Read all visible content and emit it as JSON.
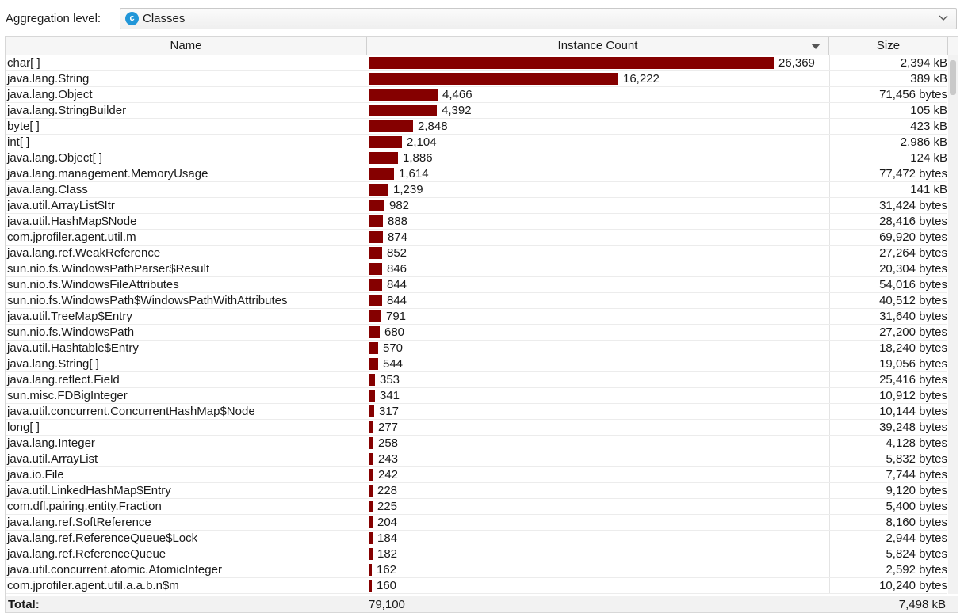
{
  "toolbar": {
    "aggregation_label": "Aggregation level:",
    "aggregation_value": "Classes",
    "aggregation_icon": "class-c-icon"
  },
  "table": {
    "columns": {
      "name": "Name",
      "instance_count": "Instance Count",
      "size": "Size"
    },
    "sort_column": "instance_count",
    "sort_direction": "descending",
    "bar_color": "#850000",
    "max_count": 26369,
    "rows": [
      {
        "name": "char[ ]",
        "count": 26369,
        "count_label": "26,369",
        "size": "2,394 kB"
      },
      {
        "name": "java.lang.String",
        "count": 16222,
        "count_label": "16,222",
        "size": "389 kB"
      },
      {
        "name": "java.lang.Object",
        "count": 4466,
        "count_label": "4,466",
        "size": "71,456 bytes"
      },
      {
        "name": "java.lang.StringBuilder",
        "count": 4392,
        "count_label": "4,392",
        "size": "105 kB"
      },
      {
        "name": "byte[ ]",
        "count": 2848,
        "count_label": "2,848",
        "size": "423 kB"
      },
      {
        "name": "int[ ]",
        "count": 2104,
        "count_label": "2,104",
        "size": "2,986 kB"
      },
      {
        "name": "java.lang.Object[ ]",
        "count": 1886,
        "count_label": "1,886",
        "size": "124 kB"
      },
      {
        "name": "java.lang.management.MemoryUsage",
        "count": 1614,
        "count_label": "1,614",
        "size": "77,472 bytes"
      },
      {
        "name": "java.lang.Class",
        "count": 1239,
        "count_label": "1,239",
        "size": "141 kB"
      },
      {
        "name": "java.util.ArrayList$Itr",
        "count": 982,
        "count_label": "982",
        "size": "31,424 bytes"
      },
      {
        "name": "java.util.HashMap$Node",
        "count": 888,
        "count_label": "888",
        "size": "28,416 bytes"
      },
      {
        "name": "com.jprofiler.agent.util.m",
        "count": 874,
        "count_label": "874",
        "size": "69,920 bytes"
      },
      {
        "name": "java.lang.ref.WeakReference",
        "count": 852,
        "count_label": "852",
        "size": "27,264 bytes"
      },
      {
        "name": "sun.nio.fs.WindowsPathParser$Result",
        "count": 846,
        "count_label": "846",
        "size": "20,304 bytes"
      },
      {
        "name": "sun.nio.fs.WindowsFileAttributes",
        "count": 844,
        "count_label": "844",
        "size": "54,016 bytes"
      },
      {
        "name": "sun.nio.fs.WindowsPath$WindowsPathWithAttributes",
        "count": 844,
        "count_label": "844",
        "size": "40,512 bytes"
      },
      {
        "name": "java.util.TreeMap$Entry",
        "count": 791,
        "count_label": "791",
        "size": "31,640 bytes"
      },
      {
        "name": "sun.nio.fs.WindowsPath",
        "count": 680,
        "count_label": "680",
        "size": "27,200 bytes"
      },
      {
        "name": "java.util.Hashtable$Entry",
        "count": 570,
        "count_label": "570",
        "size": "18,240 bytes"
      },
      {
        "name": "java.lang.String[ ]",
        "count": 544,
        "count_label": "544",
        "size": "19,056 bytes"
      },
      {
        "name": "java.lang.reflect.Field",
        "count": 353,
        "count_label": "353",
        "size": "25,416 bytes"
      },
      {
        "name": "sun.misc.FDBigInteger",
        "count": 341,
        "count_label": "341",
        "size": "10,912 bytes"
      },
      {
        "name": "java.util.concurrent.ConcurrentHashMap$Node",
        "count": 317,
        "count_label": "317",
        "size": "10,144 bytes"
      },
      {
        "name": "long[ ]",
        "count": 277,
        "count_label": "277",
        "size": "39,248 bytes"
      },
      {
        "name": "java.lang.Integer",
        "count": 258,
        "count_label": "258",
        "size": "4,128 bytes"
      },
      {
        "name": "java.util.ArrayList",
        "count": 243,
        "count_label": "243",
        "size": "5,832 bytes"
      },
      {
        "name": "java.io.File",
        "count": 242,
        "count_label": "242",
        "size": "7,744 bytes"
      },
      {
        "name": "java.util.LinkedHashMap$Entry",
        "count": 228,
        "count_label": "228",
        "size": "9,120 bytes"
      },
      {
        "name": "com.dfl.pairing.entity.Fraction",
        "count": 225,
        "count_label": "225",
        "size": "5,400 bytes"
      },
      {
        "name": "java.lang.ref.SoftReference",
        "count": 204,
        "count_label": "204",
        "size": "8,160 bytes"
      },
      {
        "name": "java.lang.ref.ReferenceQueue$Lock",
        "count": 184,
        "count_label": "184",
        "size": "2,944 bytes"
      },
      {
        "name": "java.lang.ref.ReferenceQueue",
        "count": 182,
        "count_label": "182",
        "size": "5,824 bytes"
      },
      {
        "name": "java.util.concurrent.atomic.AtomicInteger",
        "count": 162,
        "count_label": "162",
        "size": "2,592 bytes"
      },
      {
        "name": "com.jprofiler.agent.util.a.a.b.n$m",
        "count": 160,
        "count_label": "160",
        "size": "10,240 bytes"
      }
    ],
    "total": {
      "label": "Total:",
      "count": "79,100",
      "size": "7,498 kB"
    }
  }
}
